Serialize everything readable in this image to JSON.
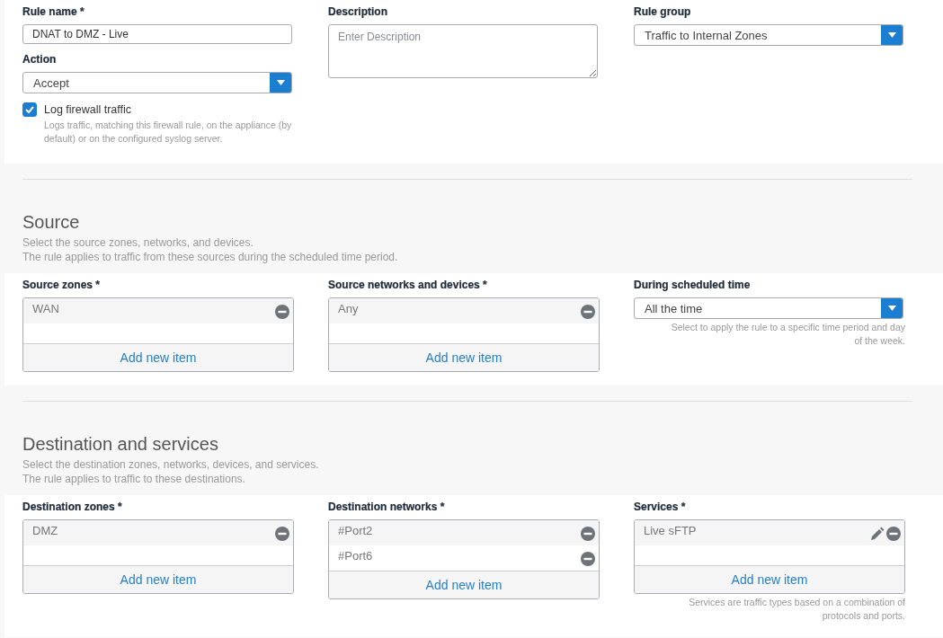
{
  "general": {
    "rule_name": {
      "label": "Rule name *",
      "value": "DNAT to DMZ - Live"
    },
    "action": {
      "label": "Action",
      "value": "Accept"
    },
    "log_traffic": {
      "label": "Log firewall traffic",
      "checked": true,
      "hint": "Logs traffic, matching this firewall rule, on the appliance (by default) or on the configured syslog server."
    },
    "description": {
      "label": "Description",
      "placeholder": "Enter Description"
    },
    "rule_group": {
      "label": "Rule group",
      "value": "Traffic to Internal Zones"
    }
  },
  "sections": [
    {
      "title": "Source",
      "subtitle_lines": [
        "Select the source zones, networks, and devices.",
        "The rule applies to traffic from these sources during the scheduled time period."
      ],
      "fields": [
        {
          "kind": "list",
          "label": "Source zones *",
          "items": [
            {
              "text": "WAN",
              "editable": false
            }
          ],
          "add_label": "Add new item"
        },
        {
          "kind": "list",
          "label": "Source networks and devices *",
          "items": [
            {
              "text": "Any",
              "editable": false
            }
          ],
          "add_label": "Add new item"
        },
        {
          "kind": "select",
          "label": "During scheduled time",
          "value": "All the time",
          "hint": "Select to apply the rule to a specific time period and day of the week."
        }
      ]
    },
    {
      "title": "Destination and services",
      "subtitle_lines": [
        "Select the destination zones, networks, devices, and services.",
        "The rule applies to traffic to these destinations."
      ],
      "fields": [
        {
          "kind": "list",
          "label": "Destination zones *",
          "items": [
            {
              "text": "DMZ",
              "editable": false
            }
          ],
          "add_label": "Add new item"
        },
        {
          "kind": "list",
          "label": "Destination networks *",
          "items": [
            {
              "text": "#Port2",
              "editable": false
            },
            {
              "text": "#Port6",
              "editable": false
            }
          ],
          "add_label": "Add new item"
        },
        {
          "kind": "list",
          "label": "Services *",
          "items": [
            {
              "text": "Live sFTP",
              "editable": true
            }
          ],
          "add_label": "Add new item",
          "hint": "Services are traffic types based on a combination of protocols and ports."
        }
      ]
    }
  ]
}
